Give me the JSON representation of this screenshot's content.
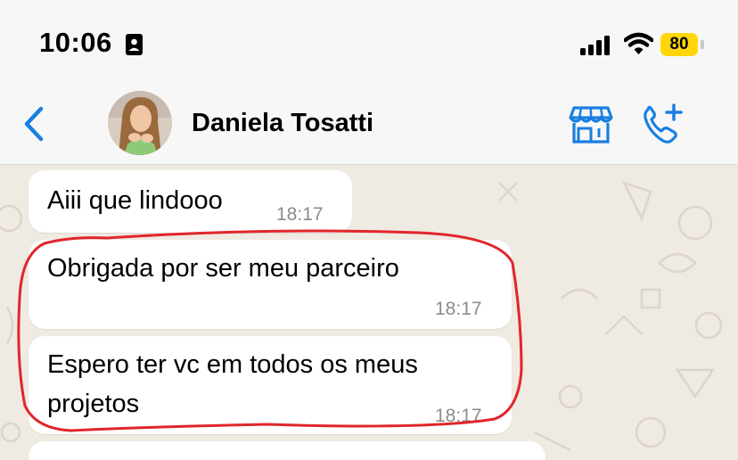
{
  "status": {
    "time": "10:06",
    "battery": "80"
  },
  "header": {
    "contact_name": "Daniela Tosatti",
    "back_icon": "chevron-left-icon",
    "store_icon": "storefront-icon",
    "call_icon": "add-call-icon"
  },
  "colors": {
    "accent": "#1a7fe0",
    "battery": "#ffd60a",
    "chat_background": "#efeae2",
    "highlight": "#e0262b"
  },
  "messages": [
    {
      "text": "Aiii que lindooo",
      "time": "18:17"
    },
    {
      "text": "Obrigada por ser meu parceiro",
      "time": "18:17"
    },
    {
      "line1": "Espero ter vc em todos os meus",
      "line2": "projetos",
      "time": "18:17"
    }
  ]
}
